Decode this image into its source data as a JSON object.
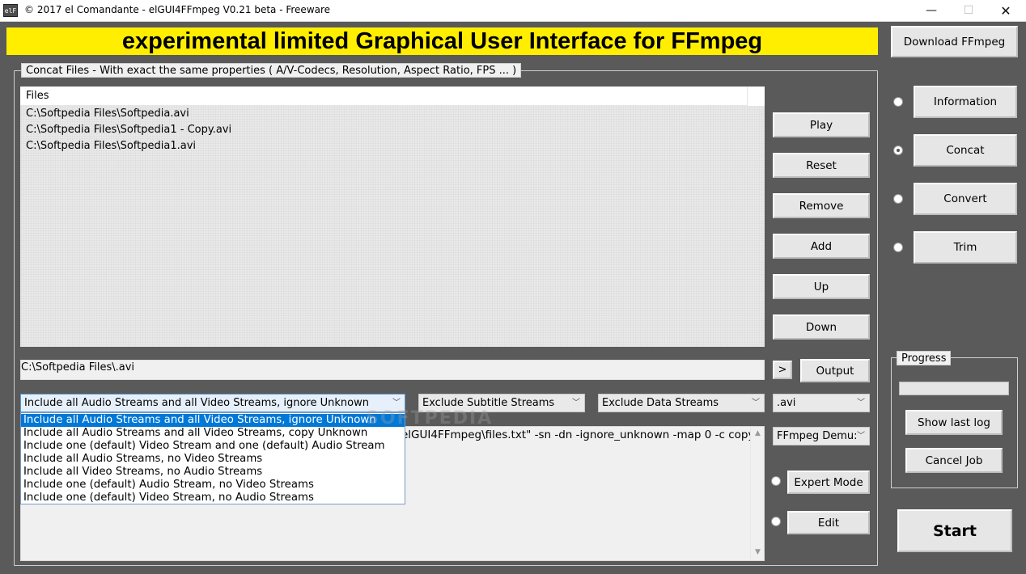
{
  "window": {
    "title": "© 2017 el Comandante - elGUI4FFmpeg V0.21 beta - Freeware",
    "icon_label": "elF",
    "minimize": "—",
    "maximize": "☐",
    "close": "✕"
  },
  "banner": {
    "text": "experimental limited Graphical User Interface for FFmpeg",
    "color": "#ffee00"
  },
  "download_button": "Download FFmpeg",
  "concat_group": {
    "legend": "Concat Files - With exact the same properties ( A/V-Codecs, Resolution, Aspect Ratio, FPS ... )",
    "file_list": {
      "header": "Files",
      "items": [
        "C:\\Softpedia Files\\Softpedia.avi",
        "C:\\Softpedia Files\\Softpedia1 - Copy.avi",
        "C:\\Softpedia Files\\Softpedia1.avi"
      ]
    },
    "actions": {
      "play": "Play",
      "reset": "Reset",
      "remove": "Remove",
      "add": "Add",
      "up": "Up",
      "down": "Down"
    },
    "output": {
      "path": "C:\\Softpedia Files\\.avi",
      "browse": ">",
      "button": "Output"
    },
    "stream_select": {
      "selected": "Include all Audio Streams and all Video Streams, ignore Unknown",
      "options": [
        "Include all Audio Streams and all Video Streams, ignore Unknown",
        "Include all Audio Streams and all Video Streams, copy Unknown",
        "Include one (default) Video Stream and one (default) Audio Stream",
        "Include all Audio Streams, no Video Streams",
        "Include all Video Streams, no Audio Streams",
        "Include one (default) Audio Stream, no Video Streams",
        "Include one (default) Video Stream, no Audio Streams"
      ]
    },
    "subtitle_select": "Exclude Subtitle Streams",
    "data_select": "Exclude Data Streams",
    "extension_select": ".avi",
    "demuxer_select": "FFmpeg Demu:",
    "command_text": "elGUI4FFmpeg\\files.txt\" -sn -dn -ignore_unknown -map 0 -c copy",
    "expert_mode": "Expert Mode",
    "edit": "Edit",
    "watermark": "SOFTPEDIA"
  },
  "nav": {
    "information": "Information",
    "concat": "Concat",
    "convert": "Convert",
    "trim": "Trim"
  },
  "progress": {
    "legend": "Progress",
    "value": 0,
    "show_last_log": "Show last log",
    "cancel_job": "Cancel Job"
  },
  "start_button": "Start"
}
